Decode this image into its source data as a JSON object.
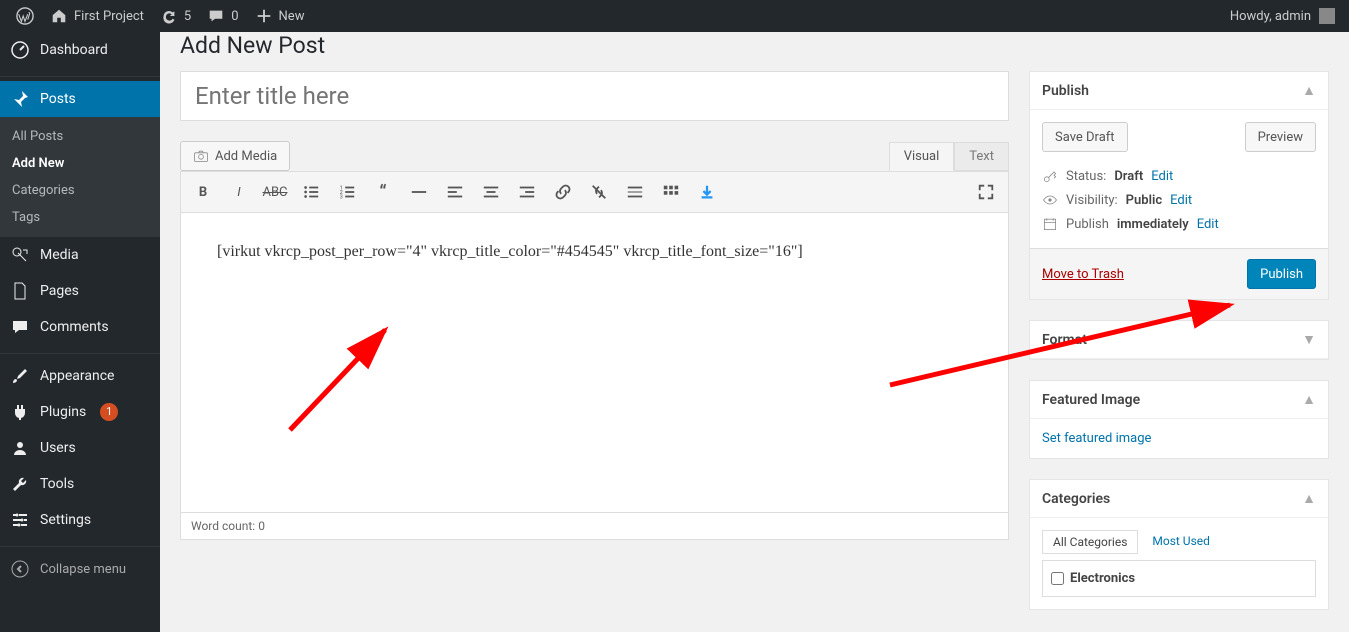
{
  "adminbar": {
    "site_name": "First Project",
    "updates_count": "5",
    "comments_count": "0",
    "new_label": "New",
    "greeting": "Howdy, admin"
  },
  "sidebar": {
    "items": [
      {
        "label": "Dashboard"
      },
      {
        "label": "Posts"
      },
      {
        "label": "Media"
      },
      {
        "label": "Pages"
      },
      {
        "label": "Comments"
      },
      {
        "label": "Appearance"
      },
      {
        "label": "Plugins",
        "badge": "1"
      },
      {
        "label": "Users"
      },
      {
        "label": "Tools"
      },
      {
        "label": "Settings"
      }
    ],
    "posts_submenu": [
      {
        "label": "All Posts"
      },
      {
        "label": "Add New"
      },
      {
        "label": "Categories"
      },
      {
        "label": "Tags"
      }
    ],
    "collapse_label": "Collapse menu"
  },
  "page": {
    "title": "Add New Post",
    "title_placeholder": "Enter title here",
    "add_media": "Add Media",
    "tab_visual": "Visual",
    "tab_text": "Text",
    "content": "[virkut vkrcp_post_per_row=\"4\" vkrcp_title_color=\"#454545\" vkrcp_title_font_size=\"16\"]",
    "word_count_label": "Word count:",
    "word_count": "0"
  },
  "publish": {
    "title": "Publish",
    "save_draft": "Save Draft",
    "preview": "Preview",
    "status_label": "Status:",
    "status_value": "Draft",
    "visibility_label": "Visibility:",
    "visibility_value": "Public",
    "publish_label": "Publish",
    "immediately": "immediately",
    "edit": "Edit",
    "trash": "Move to Trash",
    "publish_button": "Publish"
  },
  "format": {
    "title": "Format"
  },
  "featured": {
    "title": "Featured Image",
    "link": "Set featured image"
  },
  "categories": {
    "title": "Categories",
    "tab_all": "All Categories",
    "tab_most": "Most Used",
    "items": [
      "Electronics"
    ]
  }
}
